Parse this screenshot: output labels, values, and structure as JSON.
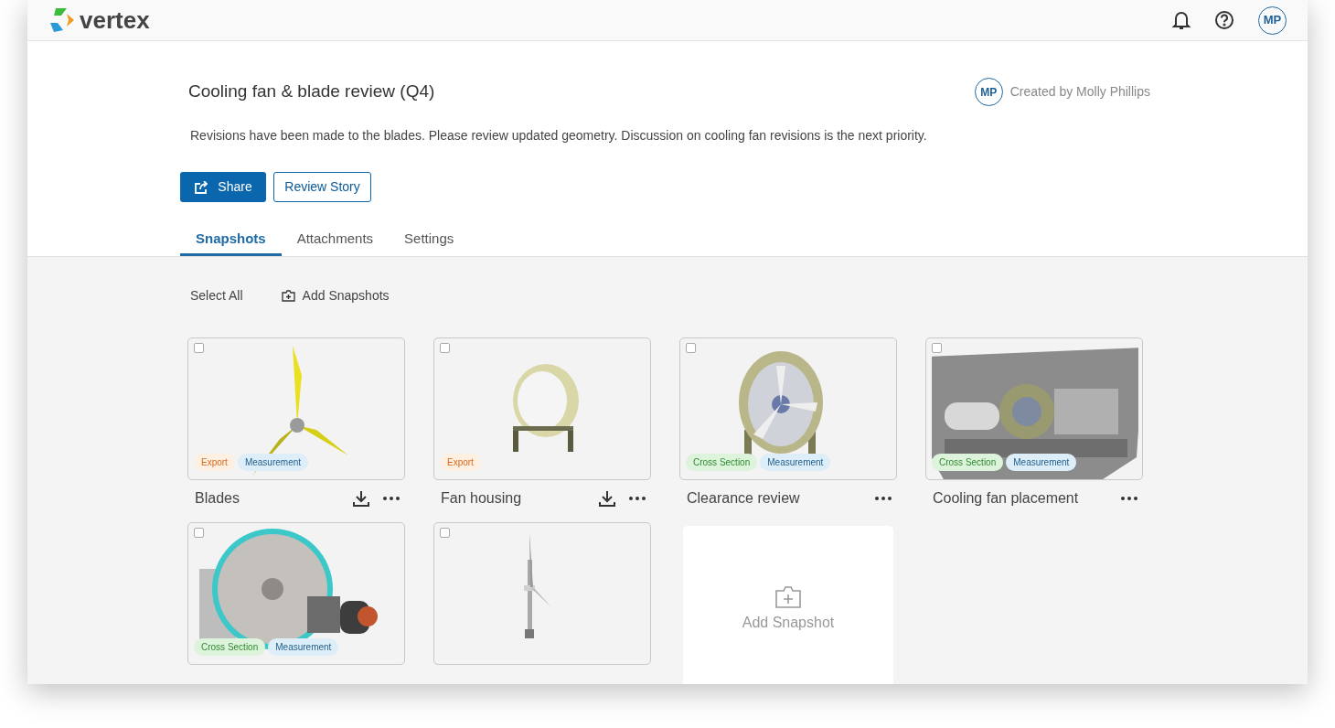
{
  "header": {
    "logo": "vertex",
    "avatar": "MP"
  },
  "story": {
    "title": "Cooling fan & blade review (Q4)",
    "creator_avatar": "MP",
    "creator": "Created by Molly Phillips",
    "description": "Revisions have been made to the blades. Please review updated geometry. Discussion on cooling fan revisions is the next priority."
  },
  "actions": {
    "share": "Share",
    "review": "Review Story"
  },
  "tabs": [
    {
      "label": "Snapshots",
      "selected": true
    },
    {
      "label": "Attachments",
      "selected": false
    },
    {
      "label": "Settings",
      "selected": false
    }
  ],
  "toolbar": {
    "select_all": "Select All",
    "add_snapshots": "Add Snapshots"
  },
  "snapshots": [
    {
      "name": "Blades",
      "checked": false,
      "download": true,
      "tags": [
        {
          "kind": "export",
          "label": "Export"
        },
        {
          "kind": "measurement",
          "label": "Measurement"
        }
      ]
    },
    {
      "name": "Fan housing",
      "checked": false,
      "download": true,
      "tags": [
        {
          "kind": "export",
          "label": "Export"
        }
      ]
    },
    {
      "name": "Clearance review",
      "checked": false,
      "download": false,
      "tags": [
        {
          "kind": "cross_section",
          "label": "Cross Section"
        },
        {
          "kind": "measurement",
          "label": "Measurement"
        }
      ]
    },
    {
      "name": "Cooling fan placement",
      "checked": false,
      "download": false,
      "tags": [
        {
          "kind": "cross_section",
          "label": "Cross Section"
        },
        {
          "kind": "measurement",
          "label": "Measurement"
        }
      ]
    },
    {
      "checked": false,
      "tags": [
        {
          "kind": "cross_section",
          "label": "Cross Section"
        },
        {
          "kind": "measurement",
          "label": "Measurement"
        }
      ]
    },
    {
      "checked": false
    }
  ],
  "add_snapshot": "Add Snapshot"
}
